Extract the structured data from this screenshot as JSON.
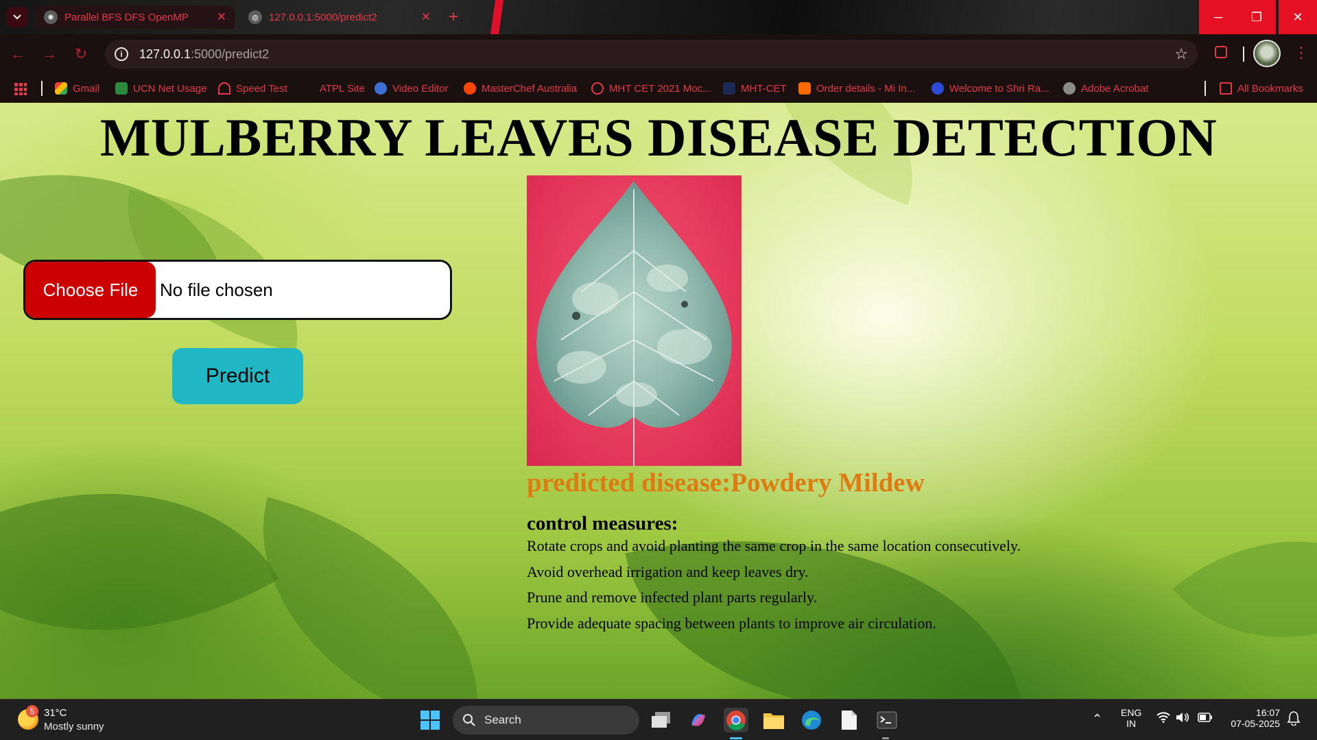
{
  "browser": {
    "tabs": [
      {
        "title": "Parallel BFS DFS OpenMP",
        "active": true
      },
      {
        "title": "127.0.0.1:5000/predict2",
        "active": false
      }
    ],
    "new_tab_label": "+",
    "url_host": "127.0.0.1",
    "url_rest": ":5000/predict2",
    "bookmarks": [
      "Gmail",
      "UCN Net Usage",
      "Speed Test",
      "ATPL Site",
      "Video Editor",
      "MasterChef Australia",
      "MHT CET 2021 Moc...",
      "MHT-CET",
      "Order details - Mi In...",
      "Welcome to Shri Ra...",
      "Adobe Acrobat"
    ],
    "all_bookmarks": "All Bookmarks",
    "accent_color": "#e53948"
  },
  "page": {
    "title": "MULBERRY LEAVES DISEASE DETECTION",
    "file_button": "Choose File",
    "file_status": "No file chosen",
    "predict_button": "Predict",
    "result_label": "predicted disease:",
    "result_value": "Powdery Mildew",
    "control_heading": "control measures:",
    "control_measures": [
      "Rotate crops and avoid planting the same crop in the same location consecutively.",
      "Avoid overhead irrigation and keep leaves dry.",
      "Prune and remove infected plant parts regularly.",
      "Provide adequate spacing between plants to improve air circulation."
    ]
  },
  "taskbar": {
    "weather_temp": "31°C",
    "weather_condition": "Mostly sunny",
    "weather_badge": "5",
    "search_label": "Search",
    "language": "ENG",
    "region": "IN",
    "time": "16:07",
    "date": "07-05-2025"
  }
}
